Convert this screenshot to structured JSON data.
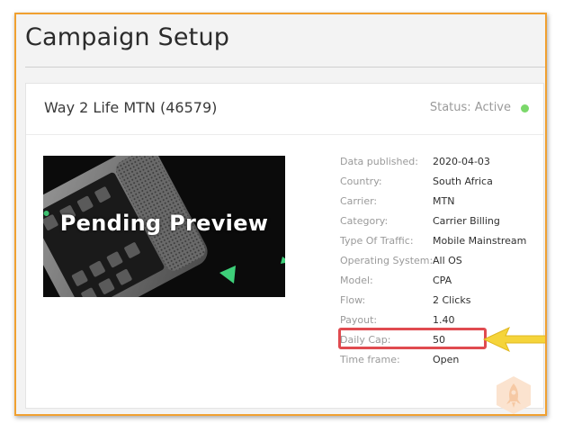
{
  "page": {
    "title": "Campaign Setup"
  },
  "campaign": {
    "name": "Way 2 Life MTN (46579)",
    "status_text": "Status: Active",
    "status_color": "#7bd86a"
  },
  "preview": {
    "label": "Pending Preview",
    "icon": "phone-preview-image"
  },
  "details": [
    {
      "label": "Data published:",
      "value": "2020-04-03"
    },
    {
      "label": "Country:",
      "value": "South Africa"
    },
    {
      "label": "Carrier:",
      "value": "MTN"
    },
    {
      "label": "Category:",
      "value": "Carrier Billing"
    },
    {
      "label": "Type Of Traffic:",
      "value": "Mobile Mainstream"
    },
    {
      "label": "Operating System:",
      "value": "All OS"
    },
    {
      "label": "Model:",
      "value": "CPA"
    },
    {
      "label": "Flow:",
      "value": "2 Clicks"
    },
    {
      "label": "Payout:",
      "value": "1.40"
    },
    {
      "label": "Daily Cap:",
      "value": "50"
    },
    {
      "label": "Time frame:",
      "value": "Open"
    }
  ],
  "annotation": {
    "highlight_color": "#e04b50",
    "arrow_color": "#f5d43a",
    "frame_color": "#f0a030",
    "arrow_icon": "yellow-arrow-icon",
    "watermark_icon": "rocket-watermark-icon"
  }
}
